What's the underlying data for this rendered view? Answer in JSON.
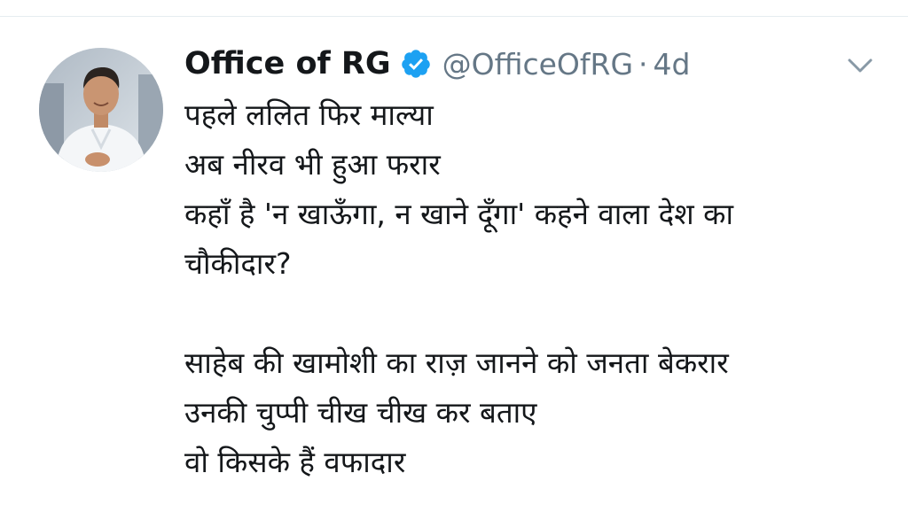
{
  "tweet": {
    "display_name": "Office of RG",
    "handle": "@OfficeOfRG",
    "separator": "·",
    "time": "4d",
    "verified": true,
    "icons": {
      "verified": "verified-badge-icon",
      "menu": "chevron-down-icon",
      "avatar": "profile-photo"
    },
    "colors": {
      "verified": "#1da1f2",
      "text": "#14171a",
      "secondary": "#657786"
    },
    "stanza1": [
      "पहले ललित फिर माल्या",
      "अब नीरव भी हुआ फरार",
      "कहाँ है 'न खाऊँगा, न खाने दूँगा' कहने वाला देश का",
      "चौकीदार?"
    ],
    "stanza2": [
      "साहेब की खामोशी का राज़ जानने को जनता बेकरार",
      "उनकी चुप्पी चीख चीख कर बताए",
      "वो किसके हैं वफादार"
    ]
  }
}
